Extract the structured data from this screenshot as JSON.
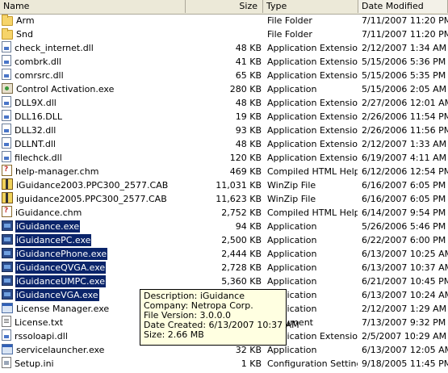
{
  "columns": {
    "name": "Name",
    "size": "Size",
    "type": "Type",
    "date": "Date Modified"
  },
  "files": [
    {
      "name": "Arm",
      "size": "",
      "type": "File Folder",
      "date": "7/11/2007 11:20 PM",
      "icon": "folder-icon",
      "selected": false
    },
    {
      "name": "Snd",
      "size": "",
      "type": "File Folder",
      "date": "7/11/2007 11:20 PM",
      "icon": "folder-icon",
      "selected": false
    },
    {
      "name": "check_internet.dll",
      "size": "48 KB",
      "type": "Application Extension",
      "date": "2/12/2007 1:34 AM",
      "icon": "dll-icon",
      "selected": false
    },
    {
      "name": "combrk.dll",
      "size": "41 KB",
      "type": "Application Extension",
      "date": "5/15/2006 5:36 PM",
      "icon": "dll-icon",
      "selected": false
    },
    {
      "name": "comrsrc.dll",
      "size": "65 KB",
      "type": "Application Extension",
      "date": "5/15/2006 5:35 PM",
      "icon": "dll-icon",
      "selected": false
    },
    {
      "name": "Control Activation.exe",
      "size": "280 KB",
      "type": "Application",
      "date": "5/15/2006 2:05 AM",
      "icon": "cpl-icon",
      "selected": false
    },
    {
      "name": "DLL9X.dll",
      "size": "48 KB",
      "type": "Application Extension",
      "date": "2/27/2006 12:01 AM",
      "icon": "dll-icon",
      "selected": false
    },
    {
      "name": "DLL16.DLL",
      "size": "19 KB",
      "type": "Application Extension",
      "date": "2/26/2006 11:54 PM",
      "icon": "dll-icon",
      "selected": false
    },
    {
      "name": "DLL32.dll",
      "size": "93 KB",
      "type": "Application Extension",
      "date": "2/26/2006 11:56 PM",
      "icon": "dll-icon",
      "selected": false
    },
    {
      "name": "DLLNT.dll",
      "size": "48 KB",
      "type": "Application Extension",
      "date": "2/12/2007 1:33 AM",
      "icon": "dll-icon",
      "selected": false
    },
    {
      "name": "filechck.dll",
      "size": "120 KB",
      "type": "Application Extension",
      "date": "6/19/2007 4:11 AM",
      "icon": "dll-icon",
      "selected": false
    },
    {
      "name": "help-manager.chm",
      "size": "469 KB",
      "type": "Compiled HTML Help...",
      "date": "6/12/2006 12:54 PM",
      "icon": "chm-icon",
      "selected": false
    },
    {
      "name": "iGuidance2003.PPC300_2577.CAB",
      "size": "11,031 KB",
      "type": "WinZip File",
      "date": "6/16/2007 6:05 PM",
      "icon": "cab-icon",
      "selected": false
    },
    {
      "name": "iguidance2005.PPC300_2577.CAB",
      "size": "11,623 KB",
      "type": "WinZip File",
      "date": "6/16/2007 6:05 PM",
      "icon": "cab-icon",
      "selected": false
    },
    {
      "name": "iGuidance.chm",
      "size": "2,752 KB",
      "type": "Compiled HTML Help...",
      "date": "6/14/2007 9:54 PM",
      "icon": "chm-icon",
      "selected": false
    },
    {
      "name": "iGuidance.exe",
      "size": "94 KB",
      "type": "Application",
      "date": "5/26/2006 5:46 PM",
      "icon": "app-icon",
      "selected": true
    },
    {
      "name": "iGuidancePC.exe",
      "size": "2,500 KB",
      "type": "Application",
      "date": "6/22/2007 6:00 PM",
      "icon": "app-icon",
      "selected": true
    },
    {
      "name": "iGuidancePhone.exe",
      "size": "2,444 KB",
      "type": "Application",
      "date": "6/13/2007 10:25 AM",
      "icon": "app-icon",
      "selected": true
    },
    {
      "name": "iGuidanceQVGA.exe",
      "size": "2,728 KB",
      "type": "Application",
      "date": "6/13/2007 10:37 AM",
      "icon": "app-icon",
      "selected": true
    },
    {
      "name": "iGuidanceUMPC.exe",
      "size": "5,360 KB",
      "type": "Application",
      "date": "6/21/2007 10:45 PM",
      "icon": "app-icon",
      "selected": true
    },
    {
      "name": "iGuidanceVGA.exe",
      "size": "",
      "type": "Application",
      "date": "6/13/2007 10:24 AM",
      "icon": "app-icon",
      "selected": true
    },
    {
      "name": "License Manager.exe",
      "size": "",
      "type": "Application",
      "date": "2/12/2007 1:29 AM",
      "icon": "exe-icon",
      "selected": false
    },
    {
      "name": "License.txt",
      "size": "",
      "type": "Document",
      "date": "7/13/2007 9:32 PM",
      "icon": "txt-icon",
      "selected": false
    },
    {
      "name": "rssoloapi.dll",
      "size": "",
      "type": "Application Extension",
      "date": "2/5/2007 10:29 AM",
      "icon": "dll-icon",
      "selected": false
    },
    {
      "name": "servicelauncher.exe",
      "size": "32 KB",
      "type": "Application",
      "date": "6/13/2007 12:05 AM",
      "icon": "exe-icon",
      "selected": false
    },
    {
      "name": "Setup.ini",
      "size": "1 KB",
      "type": "Configuration Settings",
      "date": "9/18/2005 11:45 PM",
      "icon": "ini-icon",
      "selected": false
    }
  ],
  "tooltip": {
    "description": "Description: iGuidance",
    "company": "Company: Netropa Corp.",
    "version": "File Version: 3.0.0.0",
    "created": "Date Created: 6/13/2007 10:37 AM",
    "size": "Size: 2.66 MB"
  }
}
